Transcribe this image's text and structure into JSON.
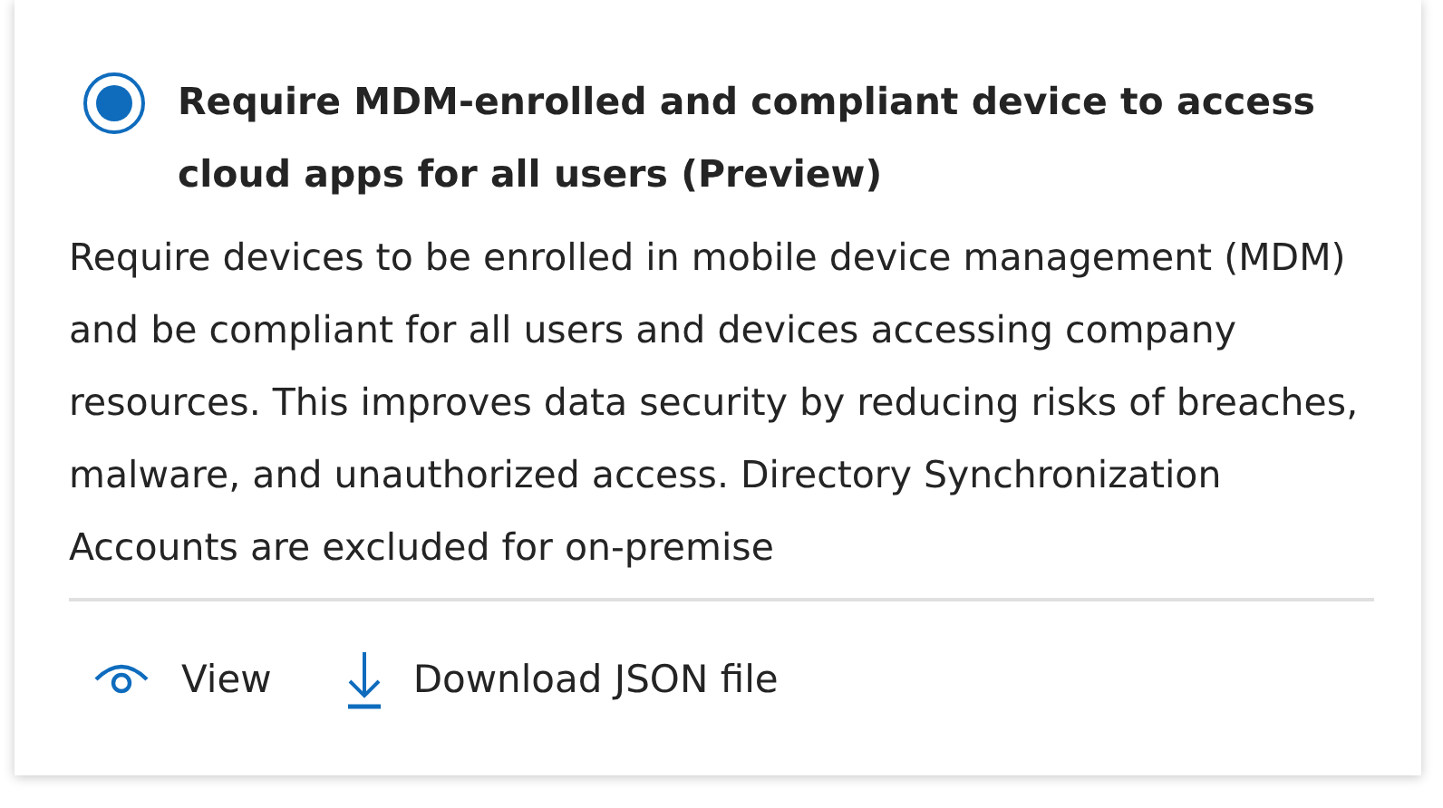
{
  "option": {
    "selected": true,
    "title": "Require MDM-enrolled and compliant device to access cloud apps for all users (Preview)",
    "description": "Require devices to be enrolled in mobile device management (MDM) and be compliant for all users and devices accessing company resources. This improves data security by reducing risks of breaches, malware, and unauthorized access. Directory Synchronization Accounts are excluded for on-premise"
  },
  "actions": [
    {
      "kind": "view",
      "label": "View"
    },
    {
      "kind": "download",
      "label": "Download JSON file"
    }
  ]
}
